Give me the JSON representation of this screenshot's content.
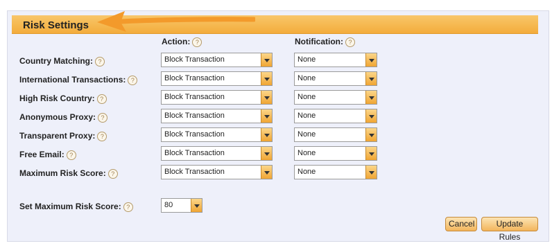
{
  "section": {
    "title": "Risk Settings"
  },
  "columns": {
    "action": "Action:",
    "notification": "Notification:"
  },
  "rules": [
    {
      "label": "Country Matching:",
      "action": "Block Transaction",
      "notification": "None"
    },
    {
      "label": "International Transactions:",
      "action": "Block Transaction",
      "notification": "None"
    },
    {
      "label": "High Risk Country:",
      "action": "Block Transaction",
      "notification": "None"
    },
    {
      "label": "Anonymous Proxy:",
      "action": "Block Transaction",
      "notification": "None"
    },
    {
      "label": "Transparent Proxy:",
      "action": "Block Transaction",
      "notification": "None"
    },
    {
      "label": "Free Email:",
      "action": "Block Transaction",
      "notification": "None"
    },
    {
      "label": "Maximum Risk Score:",
      "action": "Block Transaction",
      "notification": "None"
    }
  ],
  "max_score": {
    "label": "Set Maximum Risk Score:",
    "value": "80"
  },
  "buttons": {
    "cancel": "Cancel",
    "update": "Update Rules"
  },
  "help_glyph": "?",
  "colors": {
    "header": "#f3ac3c",
    "arrow": "#f39a2b",
    "panel": "#eef0fa"
  }
}
